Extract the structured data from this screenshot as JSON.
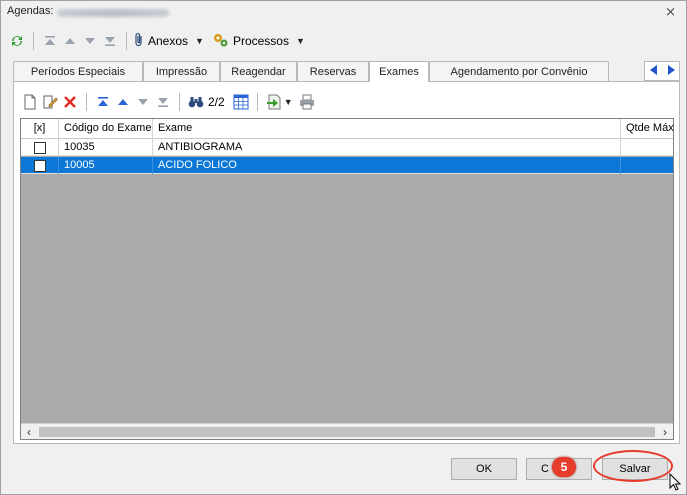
{
  "window": {
    "title_prefix": "Agendas:",
    "close_glyph": "⨯"
  },
  "toolbar": {
    "anexos_label": "Anexos",
    "processos_label": "Processos"
  },
  "tabs": [
    {
      "label": "Períodos Especiais"
    },
    {
      "label": "Impressão"
    },
    {
      "label": "Reagendar"
    },
    {
      "label": "Reservas"
    },
    {
      "label": "Exames",
      "active": true
    },
    {
      "label": "Agendamento por Convênio"
    }
  ],
  "tab_toolbar": {
    "page_count": "2/2"
  },
  "grid": {
    "columns": [
      "[x]",
      "Código do Exame",
      "Exame",
      "Qtde Máx"
    ],
    "rows": [
      {
        "checked": false,
        "codigo": "10035",
        "exame": "ANTIBIOGRAMA",
        "qtde": "",
        "selected": false
      },
      {
        "checked": false,
        "codigo": "10005",
        "exame": "ACIDO FOLICO",
        "qtde": "",
        "selected": true
      }
    ]
  },
  "footer": {
    "ok_label": "OK",
    "cancel_label": "C",
    "save_label": "Salvar",
    "step_badge": "5"
  },
  "colors": {
    "selection": "#0b78d7",
    "annotation": "#e63c2b",
    "grid_empty": "#ababab"
  }
}
